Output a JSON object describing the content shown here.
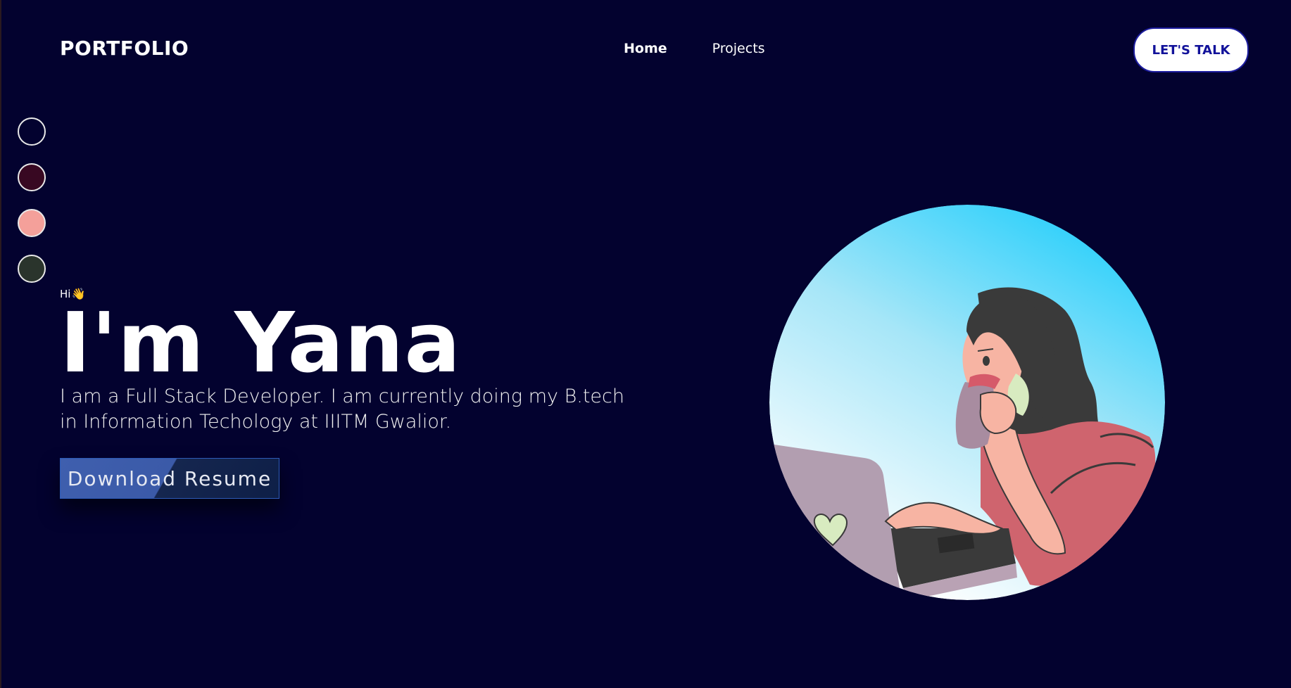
{
  "header": {
    "brand": "PORTFOLIO",
    "nav": [
      {
        "label": "Home",
        "active": true
      },
      {
        "label": "Projects",
        "active": false
      }
    ],
    "cta_label": "LET'S TALK"
  },
  "theme_swatches": [
    {
      "name": "navy",
      "color": "#03022f"
    },
    {
      "name": "maroon",
      "color": "#380822"
    },
    {
      "name": "pink",
      "color": "#f4a09a"
    },
    {
      "name": "dark-green",
      "color": "#2a342c"
    }
  ],
  "hero": {
    "greeting": "Hi",
    "greeting_emoji": "👋",
    "headline": "I'm Yana",
    "bio": "I am a Full Stack Developer. I am currently doing my B.tech in Information Techology at IIITM Gwalior.",
    "resume_button": "Download Resume"
  },
  "colors": {
    "background": "#03022f",
    "cta_text": "#12129a",
    "resume_button": "#3f5fae"
  }
}
